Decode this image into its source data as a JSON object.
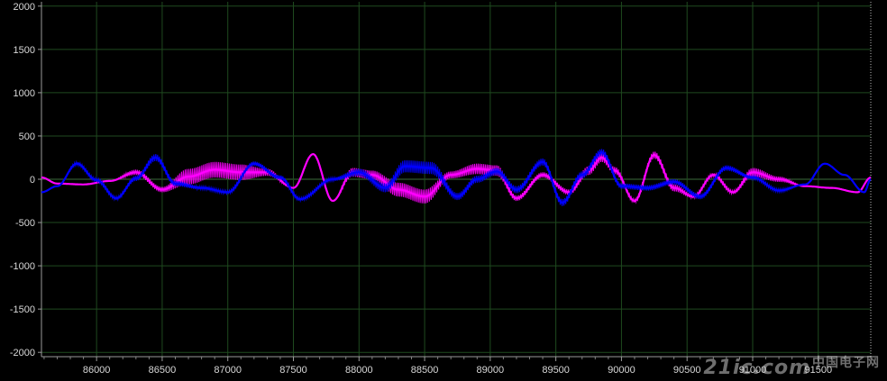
{
  "chart_data": {
    "type": "line",
    "title": "",
    "xlabel": "",
    "ylabel": "",
    "xlim": [
      85580,
      91900
    ],
    "ylim": [
      -2050,
      2050
    ],
    "grid": true,
    "x_ticks": [
      86000,
      86500,
      87000,
      87500,
      88000,
      88500,
      89000,
      89500,
      90000,
      90500,
      91000,
      91500
    ],
    "y_ticks": [
      2000,
      1500,
      1000,
      500,
      0,
      -500,
      -1000,
      -1500,
      -2000
    ],
    "series": [
      {
        "color": "#ff00ff",
        "x": [
          85580,
          85700,
          85900,
          86100,
          86300,
          86500,
          86700,
          86900,
          87100,
          87300,
          87500,
          87650,
          87800,
          87950,
          88100,
          88300,
          88500,
          88700,
          88900,
          89050,
          89200,
          89400,
          89600,
          89750,
          89850,
          89950,
          90100,
          90250,
          90400,
          90550,
          90700,
          90850,
          91000,
          91200,
          91400,
          91600,
          91800,
          91900
        ],
        "values": [
          20,
          -50,
          -60,
          -20,
          80,
          -120,
          30,
          110,
          80,
          80,
          -100,
          290,
          -250,
          80,
          50,
          -120,
          -200,
          50,
          120,
          100,
          -220,
          50,
          -150,
          100,
          250,
          100,
          -250,
          280,
          -100,
          -200,
          50,
          -150,
          80,
          0,
          -80,
          -100,
          -150,
          20
        ],
        "noise": [
          0,
          0,
          0,
          0,
          30,
          30,
          90,
          90,
          90,
          40,
          0,
          0,
          0,
          50,
          50,
          80,
          80,
          40,
          60,
          60,
          30,
          30,
          30,
          50,
          50,
          40,
          20,
          40,
          40,
          20,
          20,
          20,
          50,
          30,
          0,
          0,
          0,
          0
        ]
      },
      {
        "color": "#0000ff",
        "x": [
          85580,
          85700,
          85850,
          86000,
          86150,
          86300,
          86450,
          86600,
          86800,
          87000,
          87200,
          87400,
          87550,
          87800,
          88000,
          88200,
          88350,
          88550,
          88750,
          88900,
          89050,
          89200,
          89400,
          89550,
          89700,
          89850,
          90000,
          90200,
          90400,
          90600,
          90800,
          91000,
          91200,
          91400,
          91550,
          91700,
          91850,
          91900
        ],
        "values": [
          -150,
          -80,
          180,
          -10,
          -220,
          10,
          250,
          -50,
          -100,
          -150,
          180,
          20,
          -230,
          0,
          80,
          -100,
          150,
          130,
          -200,
          0,
          90,
          -120,
          200,
          -270,
          50,
          310,
          -80,
          -100,
          -30,
          -200,
          130,
          20,
          -130,
          -60,
          180,
          50,
          -150,
          0
        ],
        "noise": [
          0,
          0,
          20,
          20,
          20,
          30,
          40,
          30,
          20,
          20,
          25,
          25,
          20,
          20,
          40,
          50,
          70,
          70,
          40,
          40,
          40,
          40,
          40,
          40,
          40,
          40,
          30,
          30,
          30,
          30,
          30,
          20,
          20,
          0,
          0,
          0,
          0,
          0
        ]
      }
    ]
  },
  "watermark": {
    "latin": "21ic.com",
    "cn": "中国电子网"
  }
}
